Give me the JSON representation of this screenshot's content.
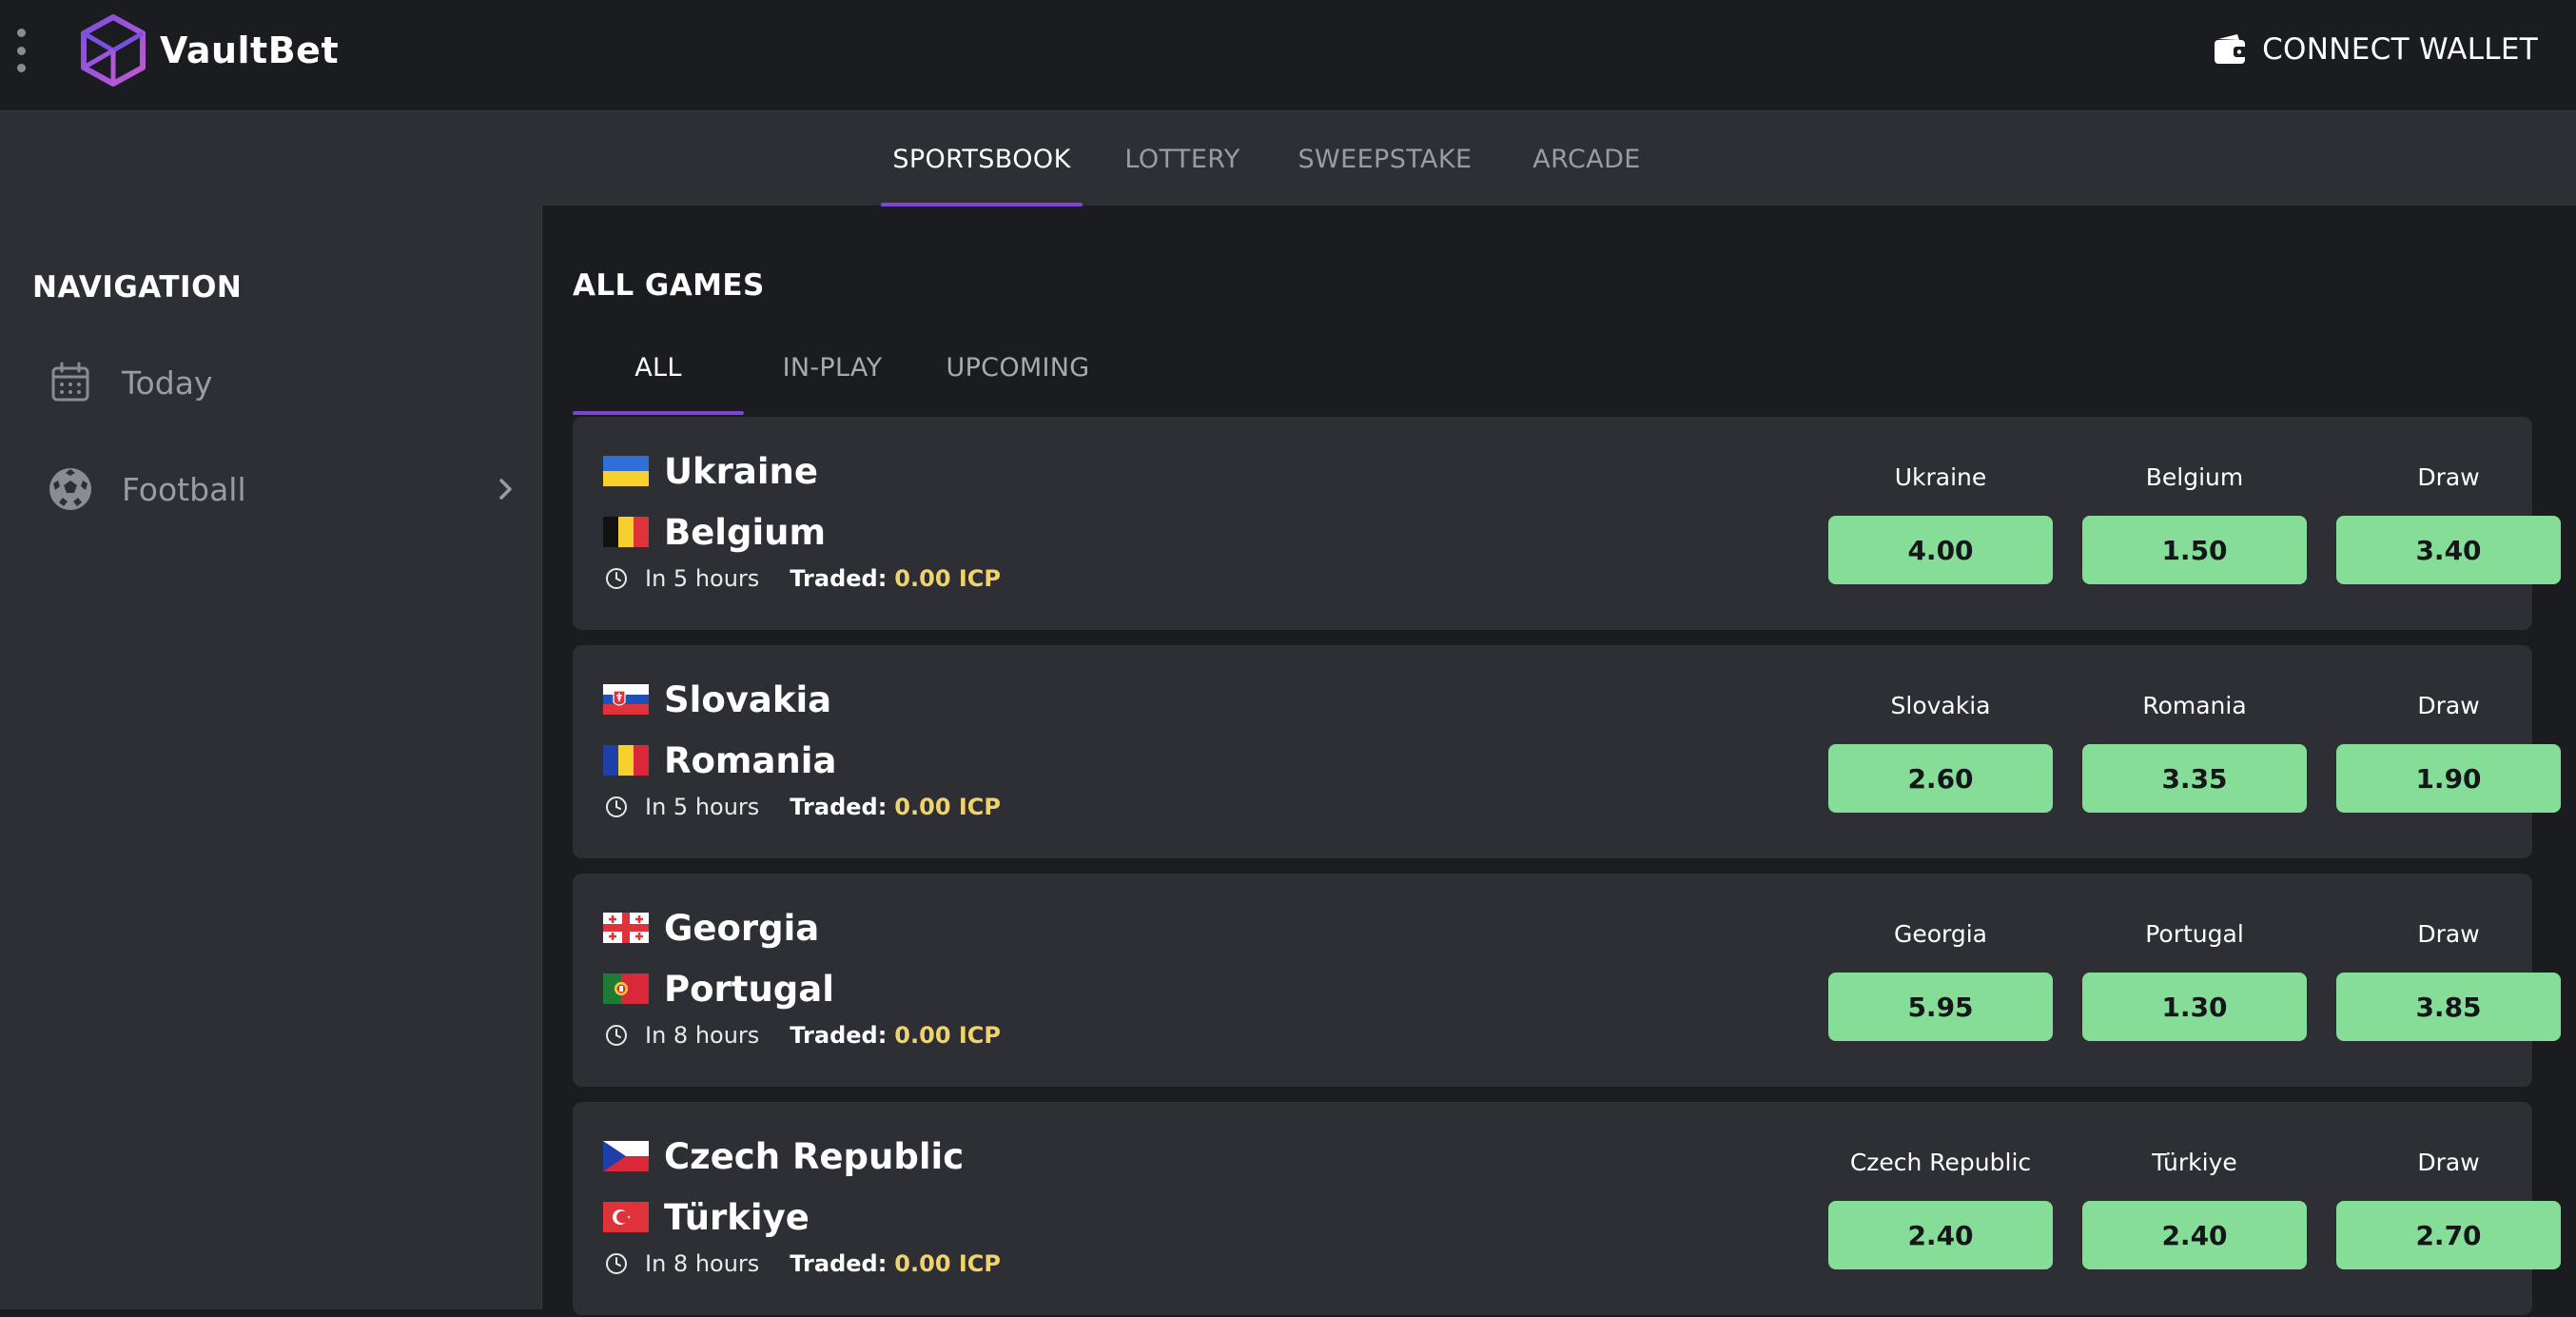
{
  "app": {
    "brand": "VaultBet",
    "connect_wallet": "CONNECT WALLET"
  },
  "top_tabs": [
    {
      "label": "SPORTSBOOK",
      "active": true
    },
    {
      "label": "LOTTERY",
      "active": false
    },
    {
      "label": "SWEEPSTAKE",
      "active": false
    },
    {
      "label": "ARCADE",
      "active": false
    }
  ],
  "sidebar": {
    "title": "NAVIGATION",
    "items": [
      {
        "label": "Today",
        "icon": "calendar-icon"
      },
      {
        "label": "Football",
        "icon": "soccer-ball-icon"
      }
    ]
  },
  "main": {
    "title": "ALL GAMES",
    "tabs": [
      {
        "label": "ALL",
        "active": true
      },
      {
        "label": "IN-PLAY",
        "active": false
      },
      {
        "label": "UPCOMING",
        "active": false
      }
    ],
    "traded_label": "Traded:",
    "matches": [
      {
        "home": "Ukraine",
        "away": "Belgium",
        "home_flag": "ukraine-flag",
        "away_flag": "belgium-flag",
        "time": "In 5 hours",
        "traded": "0.00 ICP",
        "odds": [
          {
            "label": "Ukraine",
            "value": "4.00"
          },
          {
            "label": "Belgium",
            "value": "1.50"
          },
          {
            "label": "Draw",
            "value": "3.40"
          }
        ]
      },
      {
        "home": "Slovakia",
        "away": "Romania",
        "home_flag": "slovakia-flag",
        "away_flag": "romania-flag",
        "time": "In 5 hours",
        "traded": "0.00 ICP",
        "odds": [
          {
            "label": "Slovakia",
            "value": "2.60"
          },
          {
            "label": "Romania",
            "value": "3.35"
          },
          {
            "label": "Draw",
            "value": "1.90"
          }
        ]
      },
      {
        "home": "Georgia",
        "away": "Portugal",
        "home_flag": "georgia-flag",
        "away_flag": "portugal-flag",
        "time": "In 8 hours",
        "traded": "0.00 ICP",
        "odds": [
          {
            "label": "Georgia",
            "value": "5.95"
          },
          {
            "label": "Portugal",
            "value": "1.30"
          },
          {
            "label": "Draw",
            "value": "3.85"
          }
        ]
      },
      {
        "home": "Czech Republic",
        "away": "Türkiye",
        "home_flag": "czech-republic-flag",
        "away_flag": "turkiye-flag",
        "time": "In 8 hours",
        "traded": "0.00 ICP",
        "odds": [
          {
            "label": "Czech Republic",
            "value": "2.40"
          },
          {
            "label": "Türkiye",
            "value": "2.40"
          },
          {
            "label": "Draw",
            "value": "2.70"
          }
        ]
      }
    ]
  },
  "colors": {
    "accent": "#7b45d6",
    "odds_button": "#86dd98",
    "traded_value": "#f0d36c",
    "panel": "#2d2f35",
    "background": "#1b1c20"
  }
}
